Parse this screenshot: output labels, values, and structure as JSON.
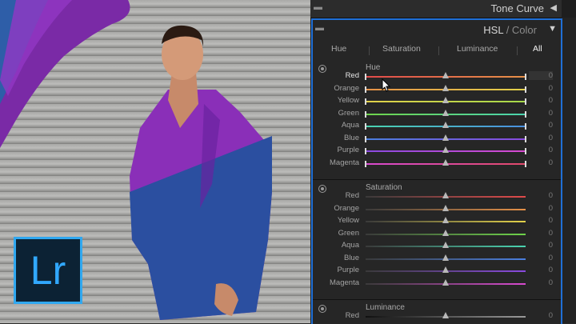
{
  "brand": {
    "logo_text": "Lr"
  },
  "panels": {
    "tone_curve": {
      "title": "Tone Curve",
      "collapse_icon": "triangle-left-icon"
    },
    "hsl": {
      "title_hsl": "HSL",
      "title_sep": " / ",
      "title_color": "Color",
      "collapse_icon": "triangle-down-icon",
      "tabs": [
        "Hue",
        "Saturation",
        "Luminance",
        "All"
      ],
      "active_tab": "All",
      "colors": [
        "Red",
        "Orange",
        "Yellow",
        "Green",
        "Aqua",
        "Blue",
        "Purple",
        "Magenta"
      ],
      "sections": [
        {
          "title": "Hue",
          "rows": [
            {
              "label": "Red",
              "value": "0"
            },
            {
              "label": "Orange",
              "value": "0"
            },
            {
              "label": "Yellow",
              "value": "0"
            },
            {
              "label": "Green",
              "value": "0"
            },
            {
              "label": "Aqua",
              "value": "0"
            },
            {
              "label": "Blue",
              "value": "0"
            },
            {
              "label": "Purple",
              "value": "0"
            },
            {
              "label": "Magenta",
              "value": "0"
            }
          ]
        },
        {
          "title": "Saturation",
          "rows": [
            {
              "label": "Red",
              "value": "0"
            },
            {
              "label": "Orange",
              "value": "0"
            },
            {
              "label": "Yellow",
              "value": "0"
            },
            {
              "label": "Green",
              "value": "0"
            },
            {
              "label": "Aqua",
              "value": "0"
            },
            {
              "label": "Blue",
              "value": "0"
            },
            {
              "label": "Purple",
              "value": "0"
            },
            {
              "label": "Magenta",
              "value": "0"
            }
          ]
        },
        {
          "title": "Luminance",
          "rows": [
            {
              "label": "Red",
              "value": "0"
            }
          ]
        }
      ]
    }
  },
  "palette": {
    "accent": "#1f6fd6",
    "hue_tracks": [
      [
        "#e14a4a",
        "#e69148"
      ],
      [
        "#e69148",
        "#e3d24a"
      ],
      [
        "#e3d24a",
        "#a5d94a"
      ],
      [
        "#6fd44a",
        "#4ad4b0"
      ],
      [
        "#4ad4b0",
        "#4a8fe0"
      ],
      [
        "#4a7fe0",
        "#8a4ae0"
      ],
      [
        "#8a4ae0",
        "#d84ad0"
      ],
      [
        "#d84ad0",
        "#e14a6a"
      ]
    ],
    "sat_tracks": [
      "#e14a4a",
      "#e69148",
      "#e3d24a",
      "#6fd44a",
      "#4ad4b0",
      "#4a7fe0",
      "#8a4ae0",
      "#d84ad0"
    ]
  }
}
